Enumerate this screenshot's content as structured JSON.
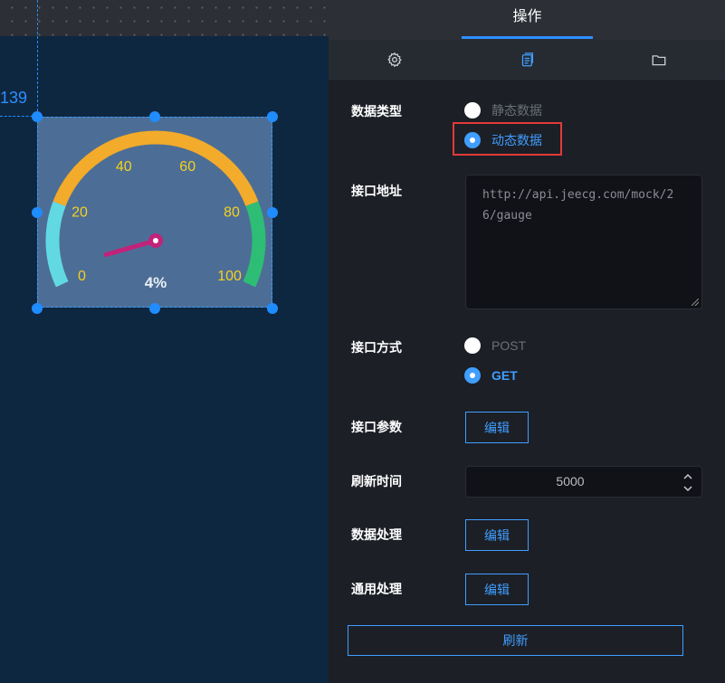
{
  "canvas": {
    "coord_label": "139",
    "gauge": {
      "ticks": [
        "0",
        "20",
        "40",
        "60",
        "80",
        "100"
      ],
      "value_text": "4%",
      "value": 4,
      "min": 0,
      "max": 100,
      "band_colors": [
        "#62d9e2",
        "#f2ab2a",
        "#2ebd75"
      ],
      "tick_color": "#f5d020",
      "pointer_color": "#c2227a"
    }
  },
  "panel": {
    "title": "操作",
    "tabs": [
      {
        "icon": "gear-icon"
      },
      {
        "icon": "copy-icon"
      },
      {
        "icon": "folder-icon"
      }
    ],
    "data_type": {
      "label": "数据类型",
      "options": [
        "静态数据",
        "动态数据"
      ],
      "selected": "动态数据"
    },
    "api_url": {
      "label": "接口地址",
      "value": "http://api.jeecg.com/mock/26/gauge"
    },
    "api_method": {
      "label": "接口方式",
      "options": [
        "POST",
        "GET"
      ],
      "selected": "GET"
    },
    "api_params": {
      "label": "接口参数",
      "button": "编辑"
    },
    "refresh_time": {
      "label": "刷新时间",
      "value": "5000"
    },
    "data_processing": {
      "label": "数据处理",
      "button": "编辑"
    },
    "common_processing": {
      "label": "通用处理",
      "button": "编辑"
    },
    "refresh_button": "刷新",
    "accent_color": "#409eff",
    "highlight_color": "#e23a3a"
  }
}
